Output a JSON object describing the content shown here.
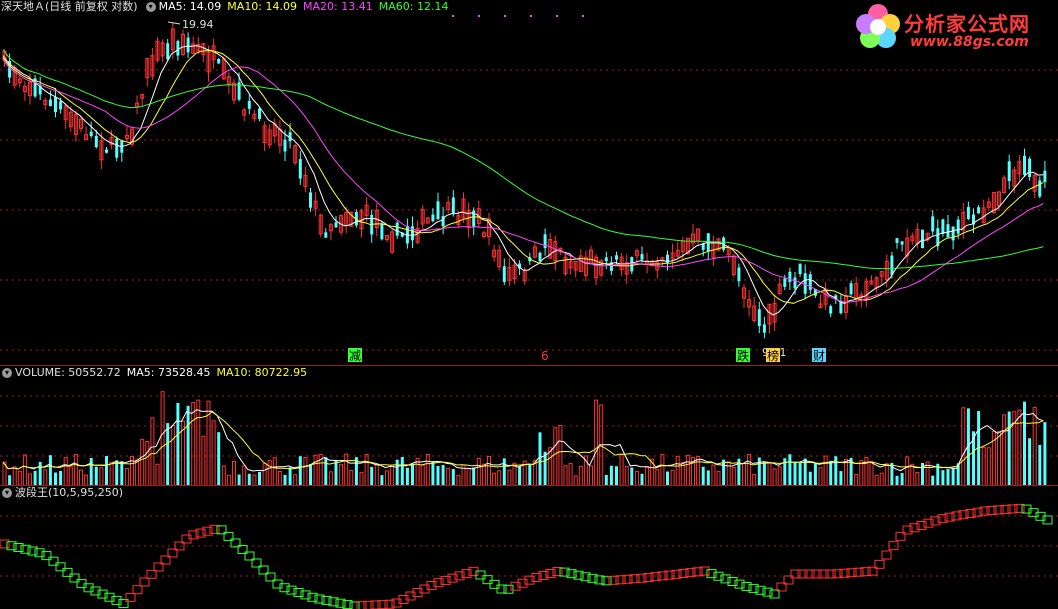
{
  "main": {
    "title": "深天地Ａ(日线 前复权 对数)",
    "ma5": {
      "label": "MA5: 14.09",
      "color": "#ffffff"
    },
    "ma10": {
      "label": "MA10: 14.09",
      "color": "#ffff33"
    },
    "ma20": {
      "label": "MA20: 13.41",
      "color": "#ff44ff"
    },
    "ma60": {
      "label": "MA60: 12.14",
      "color": "#33ff33"
    },
    "high_label": "19.94",
    "low_label": "9.81",
    "markers": [
      "减",
      "6",
      "跌",
      "榜",
      "财"
    ]
  },
  "volume": {
    "title": "VOLUME: 50552.72",
    "ma5": {
      "label": "MA5: 73528.45",
      "color": "#ffffff"
    },
    "ma10": {
      "label": "MA10: 80722.95",
      "color": "#ffff33"
    }
  },
  "indicator": {
    "title": "波段王(10,5,95,250)"
  },
  "logo": {
    "title": "分析家公式网",
    "url": "www.88gs.com"
  },
  "colors": {
    "up": "#ff3232",
    "down": "#54ffff",
    "grid": "#9a1f1f",
    "ind_down": "#33ff33"
  }
}
